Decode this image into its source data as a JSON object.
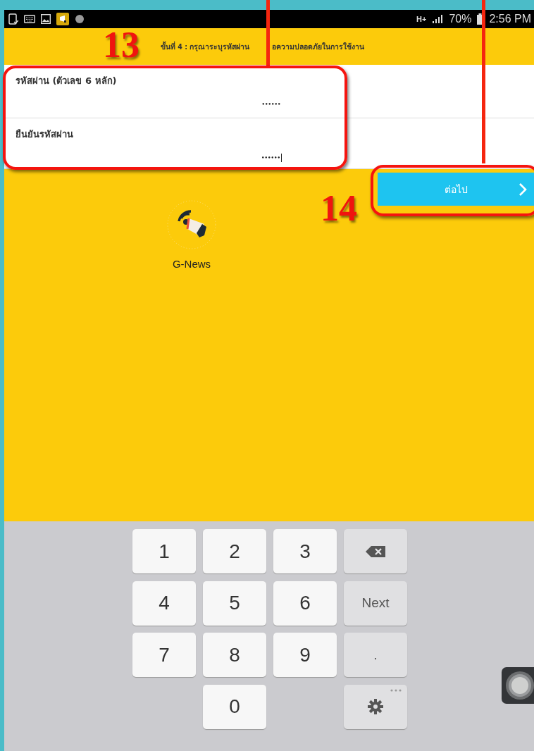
{
  "status_bar": {
    "network": "H+",
    "battery": "70%",
    "time": "2:56 PM"
  },
  "header": {
    "step_text_parts": [
      "ขั้นที่ 4 : กรุณาระบุรหัสผ่าน",
      "อความปลอดภัยในการใช้งาน"
    ]
  },
  "fields": [
    {
      "label": "รหัสผ่าน (ตัวเลข 6 หลัก)",
      "value": "••••••",
      "focused": false
    },
    {
      "label": "ยืนยันรหัสผ่าน",
      "value": "••••••",
      "focused": true
    }
  ],
  "next_button": {
    "label": "ต่อไป"
  },
  "app": {
    "name": "G-News"
  },
  "annotations": [
    {
      "label": "13"
    },
    {
      "label": "14"
    }
  ],
  "keyboard": [
    {
      "kind": "digit",
      "label": "1"
    },
    {
      "kind": "digit",
      "label": "2"
    },
    {
      "kind": "digit",
      "label": "3"
    },
    {
      "kind": "backspace"
    },
    {
      "kind": "digit",
      "label": "4"
    },
    {
      "kind": "digit",
      "label": "5"
    },
    {
      "kind": "digit",
      "label": "6"
    },
    {
      "kind": "action",
      "label": "Next"
    },
    {
      "kind": "digit",
      "label": "7"
    },
    {
      "kind": "digit",
      "label": "8"
    },
    {
      "kind": "digit",
      "label": "9"
    },
    {
      "kind": "action",
      "label": "."
    },
    {
      "kind": "empty"
    },
    {
      "kind": "digit",
      "label": "0"
    },
    {
      "kind": "empty"
    },
    {
      "kind": "settings"
    }
  ]
}
